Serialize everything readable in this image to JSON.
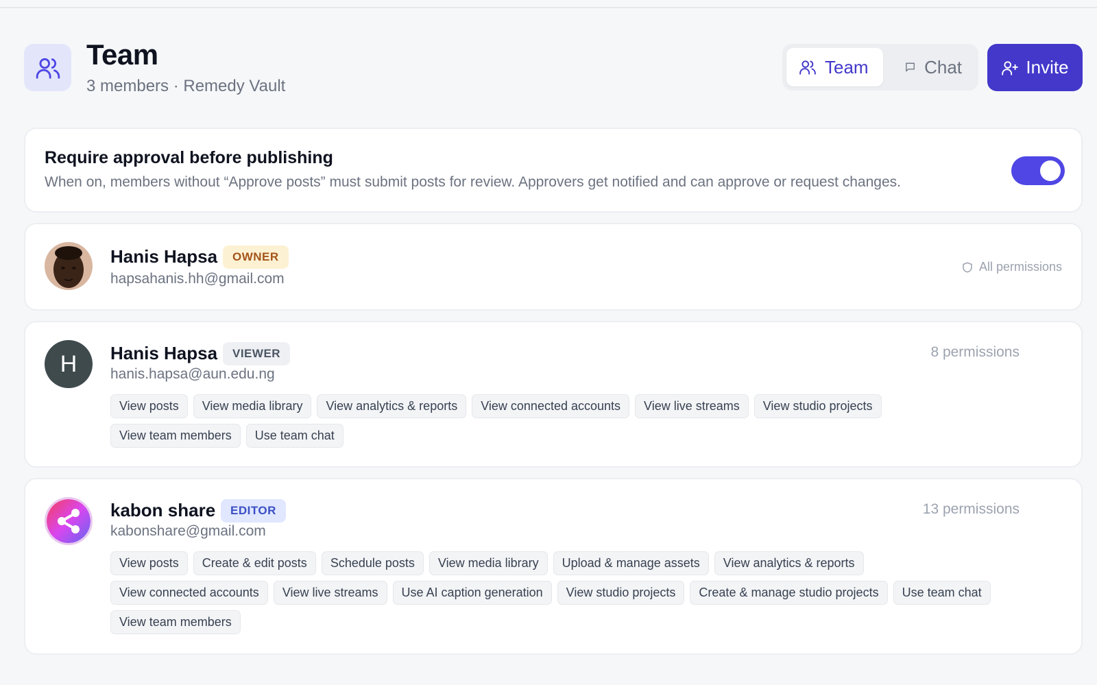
{
  "header": {
    "icon": "users-icon",
    "title": "Team",
    "subtitle": "3 members · Remedy Vault"
  },
  "tabs": [
    {
      "label": "Team",
      "icon": "users-icon",
      "active": true
    },
    {
      "label": "Chat",
      "icon": "chat-bubble-icon",
      "active": false
    }
  ],
  "invite": {
    "label": "Invite",
    "icon": "user-plus-icon"
  },
  "approval": {
    "title": "Require approval before publishing",
    "description": "When on, members without “Approve posts” must submit posts for review. Approvers get notified and can approve or request changes.",
    "enabled": true
  },
  "members": [
    {
      "name": "Hanis Hapsa",
      "role": "OWNER",
      "email": "hapsahanis.hh@gmail.com",
      "permissions_label": "All permissions",
      "permissions_icon": "shield-icon",
      "avatar": "photo"
    },
    {
      "name": "Hanis Hapsa",
      "role": "VIEWER",
      "email": "hanis.hapsa@aun.edu.ng",
      "permissions_label": "8 permissions",
      "avatar_initial": "H",
      "permissions": [
        "View posts",
        "View media library",
        "View analytics & reports",
        "View connected accounts",
        "View live streams",
        "View studio projects",
        "View team members",
        "Use team chat"
      ]
    },
    {
      "name": "kabon share",
      "role": "EDITOR",
      "email": "kabonshare@gmail.com",
      "permissions_label": "13 permissions",
      "avatar": "share-icon",
      "permissions": [
        "View posts",
        "Create & edit posts",
        "Schedule posts",
        "View media library",
        "Upload & manage assets",
        "View analytics & reports",
        "View connected accounts",
        "View live streams",
        "Use AI caption generation",
        "View studio projects",
        "Create & manage studio projects",
        "Use team chat",
        "View team members"
      ]
    }
  ],
  "colors": {
    "accent": "#4338ca",
    "toggle": "#4f46e5",
    "background": "#f6f7f9"
  }
}
